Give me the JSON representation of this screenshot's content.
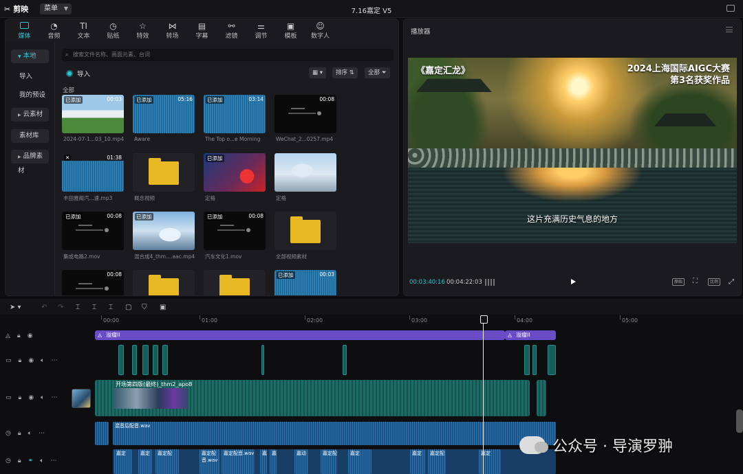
{
  "app": {
    "logo": "剪映",
    "menu": "菜单",
    "project_title": "7.16嘉定 V5"
  },
  "media_tabs": [
    {
      "label": "媒体",
      "icon": "media-icon"
    },
    {
      "label": "音频",
      "icon": "audio-icon"
    },
    {
      "label": "文本",
      "icon": "text-icon",
      "glyph": "TI"
    },
    {
      "label": "贴纸",
      "icon": "sticker-icon"
    },
    {
      "label": "特效",
      "icon": "effects-icon"
    },
    {
      "label": "转场",
      "icon": "transition-icon"
    },
    {
      "label": "字幕",
      "icon": "caption-icon"
    },
    {
      "label": "滤镜",
      "icon": "filter-icon"
    },
    {
      "label": "调节",
      "icon": "adjust-icon"
    },
    {
      "label": "模板",
      "icon": "template-icon"
    },
    {
      "label": "数字人",
      "icon": "avatar-icon"
    }
  ],
  "sidebar": {
    "items": [
      "本地",
      "导入",
      "我的预设",
      "云素材",
      "素材库",
      "品牌素材"
    ]
  },
  "search": {
    "placeholder": "搜索文件名称、画面元素、台词"
  },
  "import_label": "导入",
  "toolbar": {
    "sort": "排序",
    "all": "全部"
  },
  "group_label": "全部",
  "media_items": [
    {
      "name": "2024-07-1...03_10.mp4",
      "badge": "已添加",
      "duration": "00:03",
      "kind": "villa"
    },
    {
      "name": "Aware",
      "badge": "已添加",
      "duration": "05:16",
      "kind": "audio"
    },
    {
      "name": "The Top o...e Morning",
      "badge": "已添加",
      "duration": "03:14",
      "kind": "audio"
    },
    {
      "name": "WeChat_2...0257.mp4",
      "badge": "",
      "duration": "00:08",
      "kind": "wechat"
    },
    {
      "name": "丰田雅阁汽...速.mp3",
      "badge": "",
      "duration": "01:38",
      "kind": "audio2"
    },
    {
      "name": "概念视频",
      "badge": "",
      "duration": "",
      "kind": "folder"
    },
    {
      "name": "定格",
      "badge": "已添加",
      "duration": "",
      "kind": "red"
    },
    {
      "name": "定格",
      "badge": "",
      "duration": "",
      "kind": "dragon"
    },
    {
      "name": "集成电路2.mov",
      "badge": "已添加",
      "duration": "00:08",
      "kind": "wechat"
    },
    {
      "name": "混合成4_thm....aac.mp4",
      "badge": "已添加",
      "duration": "",
      "kind": "car"
    },
    {
      "name": "汽车文化1.mov",
      "badge": "已添加",
      "duration": "00:08",
      "kind": "wechat"
    },
    {
      "name": "全部视频素材",
      "badge": "",
      "duration": "",
      "kind": "folder"
    },
    {
      "name": "",
      "badge": "",
      "duration": "00:08",
      "kind": "wechat"
    },
    {
      "name": "",
      "badge": "",
      "duration": "",
      "kind": "folder"
    },
    {
      "name": "",
      "badge": "",
      "duration": "",
      "kind": "folder"
    },
    {
      "name": "",
      "badge": "已添加",
      "duration": "00:03",
      "kind": "audio"
    }
  ],
  "player": {
    "title": "播放器",
    "overlay_left": "《嘉定汇龙》",
    "overlay_right_1": "2024上海国际AIGC大赛",
    "overlay_right_2": "第3名获奖作品",
    "subtitle": "这片充满历史气息的地方",
    "current_time": "00:03:40:16",
    "total_time": "00:04:22:03",
    "btn_original": "原始",
    "btn_ratio": "比例"
  },
  "timeline": {
    "ruler": [
      "00:00",
      "01:00",
      "02:00",
      "03:00",
      "04:00",
      "05:00"
    ],
    "effect_label": "溢瘤II",
    "main_clip_label": "开场第四版(最终)_thm2_apo8",
    "audio_main": "混音后配音.wav",
    "audio_clips": [
      "嘉定",
      "嘉定",
      "嘉定配",
      "嘉定配音.wav",
      "嘉定配音.wav",
      "嘉",
      "嘉",
      "嘉动",
      "嘉定配",
      "嘉定",
      "嘉定",
      "嘉定配",
      "嘉定"
    ]
  },
  "watermark": "公众号 · 导演罗翀"
}
